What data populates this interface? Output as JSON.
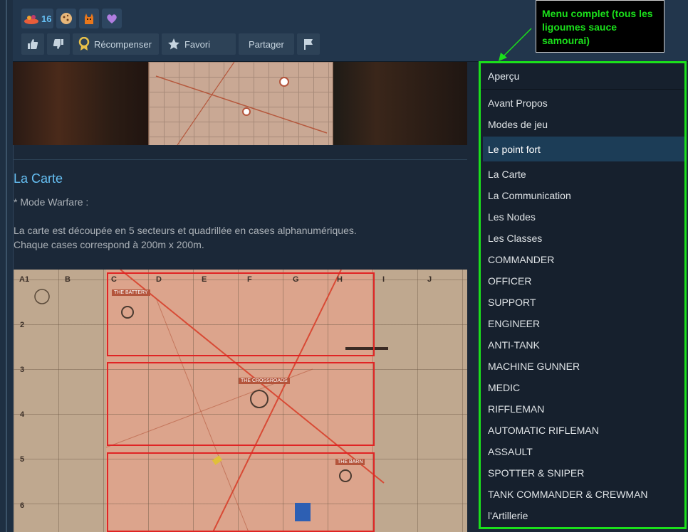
{
  "awards": {
    "items": [
      {
        "icon": "pile-award-icon",
        "count": "16"
      },
      {
        "icon": "cookie-award-icon",
        "count": ""
      },
      {
        "icon": "cat-award-icon",
        "count": ""
      },
      {
        "icon": "heart-award-icon",
        "count": ""
      }
    ]
  },
  "actions": {
    "reward_label": "Récompenser",
    "favorite_label": "Favori",
    "share_label": "Partager"
  },
  "content": {
    "section_title": "La Carte",
    "mode_line": "* Mode Warfare :",
    "desc_line1": "La carte est découpée en 5 secteurs et quadrillée en cases alphanumériques.",
    "desc_line2": "Chaque cases correspond à 200m x 200m.",
    "map": {
      "columns": [
        "A1",
        "B",
        "C",
        "D",
        "E",
        "F",
        "G",
        "H",
        "I",
        "J"
      ],
      "rows": [
        "2",
        "3",
        "4",
        "5",
        "6"
      ],
      "locations": [
        "THE BATTERY",
        "THE CROSSROADS",
        "THE BARN"
      ]
    }
  },
  "menu": {
    "header": "Aperçu",
    "items": [
      "Avant Propos",
      "Modes de jeu",
      "Le point fort",
      "La Carte",
      "La Communication",
      "Les Nodes",
      "Les Classes",
      "COMMANDER",
      "OFFICER",
      "SUPPORT",
      "ENGINEER",
      "ANTI-TANK",
      "MACHINE GUNNER",
      "MEDIC",
      "RIFFLEMAN",
      "AUTOMATIC RIFLEMAN",
      "ASSAULT",
      "SPOTTER & SNIPER",
      "TANK COMMANDER & CREWMAN",
      "l'Artillerie"
    ],
    "active_item": "Le point fort"
  },
  "annotation": {
    "text": "Menu complet (tous les ligoumes sauce samourai)"
  },
  "colors": {
    "accent": "#66c0f4",
    "annotation": "#1be01b",
    "sector": "#e02424"
  }
}
